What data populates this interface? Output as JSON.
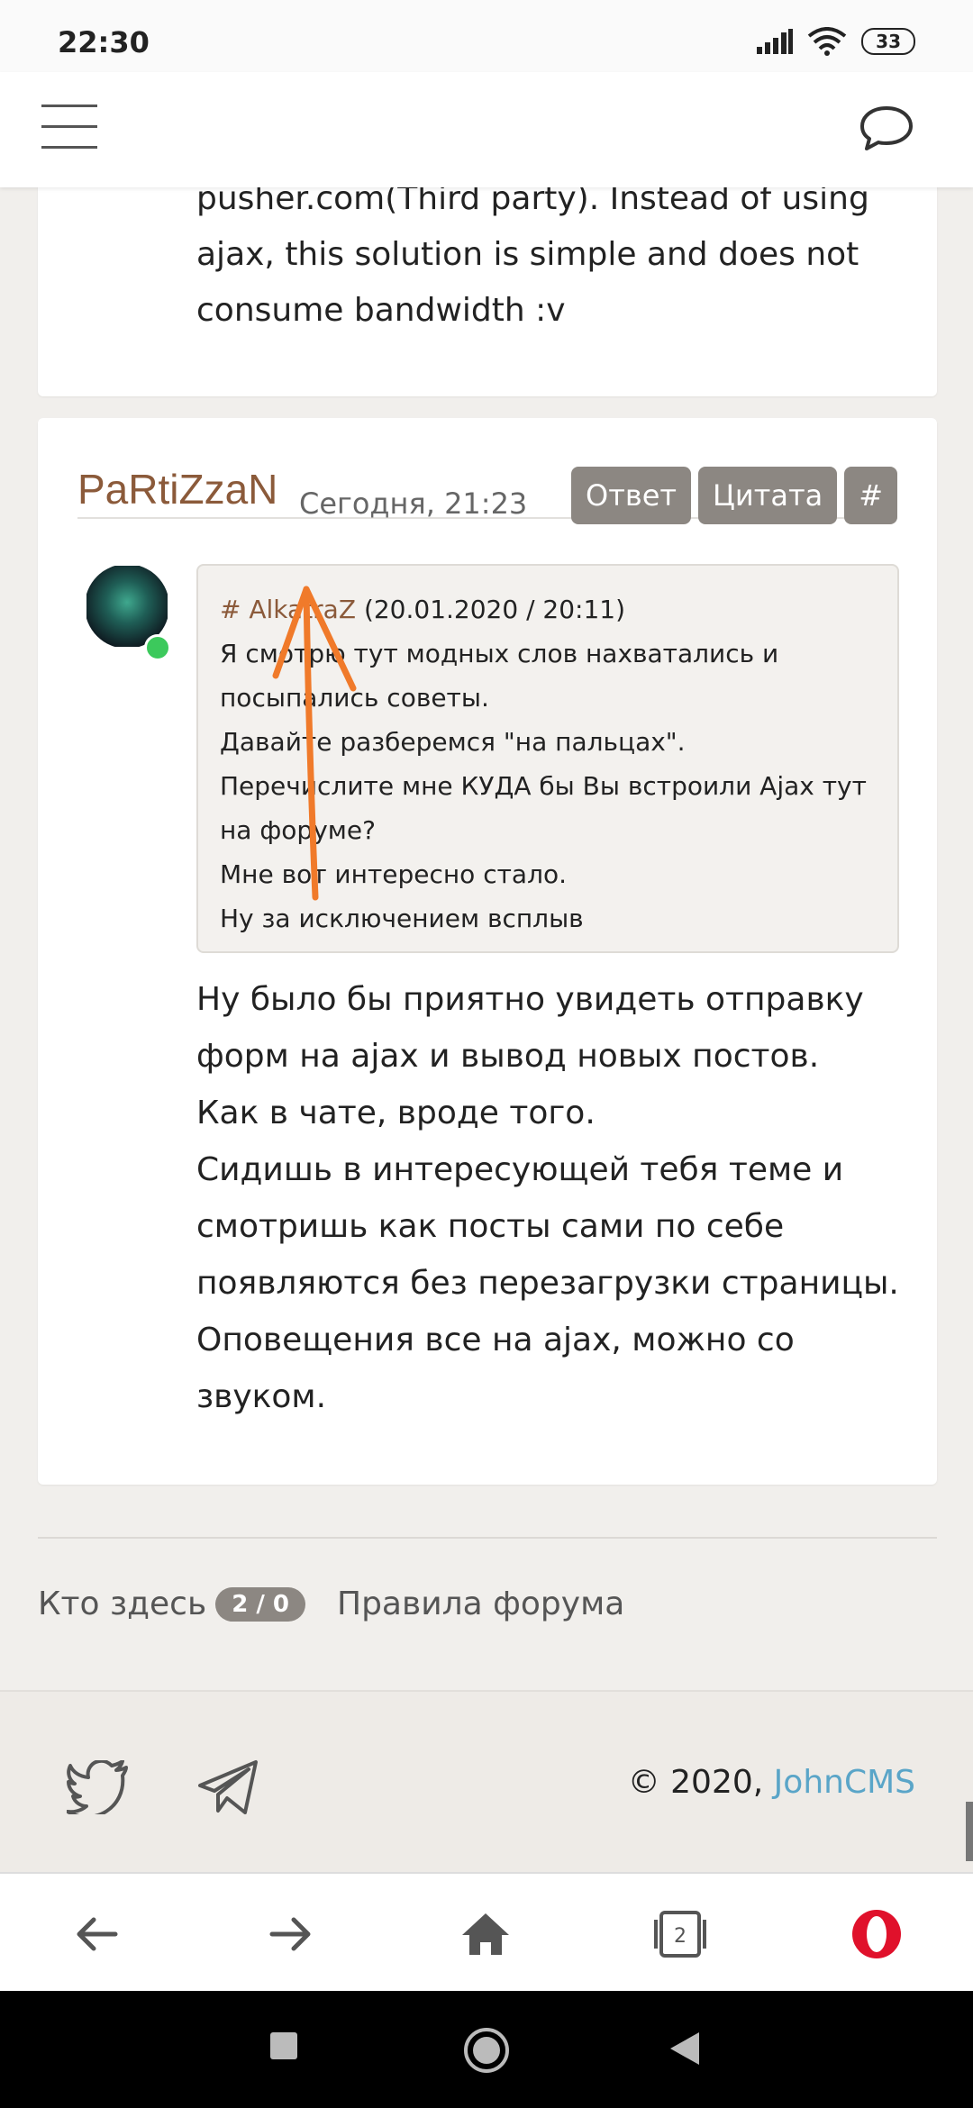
{
  "status": {
    "time": "22:30",
    "battery": "33"
  },
  "post_prev": {
    "lines": [
      "pusher.com(Third party). Instead of using",
      "ajax, this solution is simple and does not",
      "consume bandwidth :v"
    ]
  },
  "post": {
    "author": "PaRtiZzaN",
    "time": "Сегодня, 21:23",
    "actions": {
      "reply": "Ответ",
      "quote": "Цитата",
      "hash": "#"
    },
    "quote": {
      "hash": "#",
      "author": "AlkatraZ",
      "date": "(20.01.2020 / 20:11)",
      "lines": [
        "Я смотрю тут модных слов нахватались и",
        "посыпались советы.",
        "Давайте разберемся \"на пальцах\".",
        "Перечислите мне КУДА бы Вы встроили Ajax тут",
        "на форуме?",
        "Мне вот интересно стало.",
        "Ну за исключением всплыв"
      ]
    },
    "body": [
      "Ну было бы приятно увидеть отправку",
      "форм на ajax и вывод новых постов.",
      "Как в чате, вроде того.",
      "Сидишь в интересующей тебя теме и",
      "смотришь как посты сами по себе",
      "появляются без перезагрузки страницы.",
      "Оповещения все на ajax, можно со",
      "звуком."
    ]
  },
  "footer": {
    "who_label": "Кто здесь",
    "who_count": "2 / 0",
    "rules": "Правила форума",
    "copyright": "© 2020,",
    "brand": "JohnCMS"
  },
  "browser": {
    "tabs_count": "2"
  },
  "colors": {
    "accent": "#8b5a3a",
    "button": "#8c8782",
    "link": "#5aa5c8",
    "online": "#3cc95c"
  }
}
